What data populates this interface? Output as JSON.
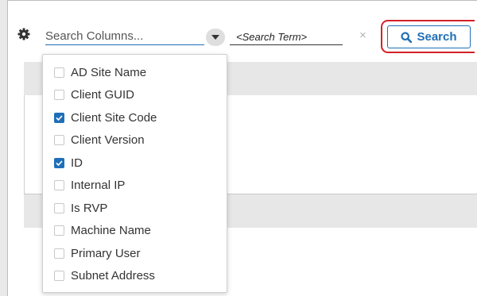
{
  "toolbar": {
    "column_search_placeholder": "Search Columns...",
    "search_term": "<Search Term>",
    "clear_glyph": "×",
    "search_label": "Search"
  },
  "columns_dropdown": {
    "options": [
      {
        "label": "AD Site Name",
        "checked": false
      },
      {
        "label": "Client GUID",
        "checked": false
      },
      {
        "label": "Client Site Code",
        "checked": true
      },
      {
        "label": "Client Version",
        "checked": false
      },
      {
        "label": "ID",
        "checked": true
      },
      {
        "label": "Internal IP",
        "checked": false
      },
      {
        "label": "Is RVP",
        "checked": false
      },
      {
        "label": "Machine Name",
        "checked": false
      },
      {
        "label": "Primary User",
        "checked": false
      },
      {
        "label": "Subnet Address",
        "checked": false
      }
    ]
  },
  "colors": {
    "accent": "#1f6fb8",
    "highlight_outline": "#d42027"
  },
  "icons": {
    "settings": "gear-icon",
    "dropdown": "chevron-down-icon",
    "clear": "close-icon",
    "search": "magnifier-icon",
    "checked": "check-icon"
  }
}
